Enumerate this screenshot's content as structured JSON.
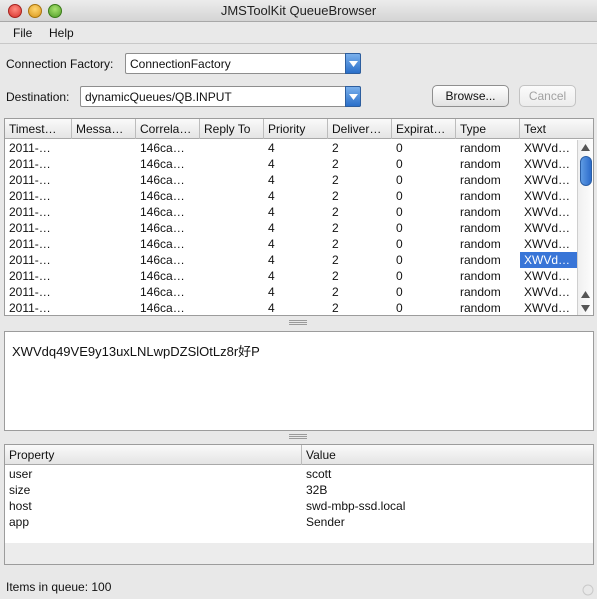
{
  "window": {
    "title": "JMSToolKit QueueBrowser"
  },
  "menu": {
    "items": [
      "File",
      "Help"
    ]
  },
  "form": {
    "connection_factory_label": "Connection Factory:",
    "connection_factory_value": "ConnectionFactory",
    "destination_label": "Destination:",
    "destination_value": "dynamicQueues/QB.INPUT",
    "browse_label": "Browse...",
    "cancel_label": "Cancel"
  },
  "messages_table": {
    "columns": [
      "Timest…",
      "Messa…",
      "Correla…",
      "Reply To",
      "Priority",
      "Deliver…",
      "Expirat…",
      "Type",
      "Text"
    ],
    "rows": [
      {
        "timestamp": "2011-…",
        "message_id": "",
        "correlation": "146ca…",
        "reply_to": "",
        "priority": "4",
        "delivery": "2",
        "expiration": "0",
        "type": "random",
        "text": "XWVd…"
      },
      {
        "timestamp": "2011-…",
        "message_id": "",
        "correlation": "146ca…",
        "reply_to": "",
        "priority": "4",
        "delivery": "2",
        "expiration": "0",
        "type": "random",
        "text": "XWVd…"
      },
      {
        "timestamp": "2011-…",
        "message_id": "",
        "correlation": "146ca…",
        "reply_to": "",
        "priority": "4",
        "delivery": "2",
        "expiration": "0",
        "type": "random",
        "text": "XWVd…"
      },
      {
        "timestamp": "2011-…",
        "message_id": "",
        "correlation": "146ca…",
        "reply_to": "",
        "priority": "4",
        "delivery": "2",
        "expiration": "0",
        "type": "random",
        "text": "XWVd…"
      },
      {
        "timestamp": "2011-…",
        "message_id": "",
        "correlation": "146ca…",
        "reply_to": "",
        "priority": "4",
        "delivery": "2",
        "expiration": "0",
        "type": "random",
        "text": "XWVd…"
      },
      {
        "timestamp": "2011-…",
        "message_id": "",
        "correlation": "146ca…",
        "reply_to": "",
        "priority": "4",
        "delivery": "2",
        "expiration": "0",
        "type": "random",
        "text": "XWVd…"
      },
      {
        "timestamp": "2011-…",
        "message_id": "",
        "correlation": "146ca…",
        "reply_to": "",
        "priority": "4",
        "delivery": "2",
        "expiration": "0",
        "type": "random",
        "text": "XWVd…"
      },
      {
        "timestamp": "2011-…",
        "message_id": "",
        "correlation": "146ca…",
        "reply_to": "",
        "priority": "4",
        "delivery": "2",
        "expiration": "0",
        "type": "random",
        "text": "XWVd…",
        "selected": true
      },
      {
        "timestamp": "2011-…",
        "message_id": "",
        "correlation": "146ca…",
        "reply_to": "",
        "priority": "4",
        "delivery": "2",
        "expiration": "0",
        "type": "random",
        "text": "XWVd…"
      },
      {
        "timestamp": "2011-…",
        "message_id": "",
        "correlation": "146ca…",
        "reply_to": "",
        "priority": "4",
        "delivery": "2",
        "expiration": "0",
        "type": "random",
        "text": "XWVd…"
      },
      {
        "timestamp": "2011-…",
        "message_id": "",
        "correlation": "146ca…",
        "reply_to": "",
        "priority": "4",
        "delivery": "2",
        "expiration": "0",
        "type": "random",
        "text": "XWVd…"
      }
    ]
  },
  "message_body": {
    "text": "XWVdq49VE9y13uxLNLwpDZSlOtLz8r好P"
  },
  "properties_table": {
    "columns": [
      "Property",
      "Value"
    ],
    "rows": [
      {
        "property": "user",
        "value": "scott"
      },
      {
        "property": "size",
        "value": "32B"
      },
      {
        "property": "host",
        "value": "swd-mbp-ssd.local"
      },
      {
        "property": "app",
        "value": "Sender"
      }
    ]
  },
  "status": {
    "text": "Items in queue: 100"
  },
  "colors": {
    "selection": "#3875d7",
    "accent": "#2a6fc9"
  },
  "icons": [
    "close-window-icon",
    "minimize-window-icon",
    "zoom-window-icon",
    "dropdown-arrow-icon",
    "scroll-up-icon",
    "scroll-down-icon",
    "resize-grip-icon"
  ]
}
